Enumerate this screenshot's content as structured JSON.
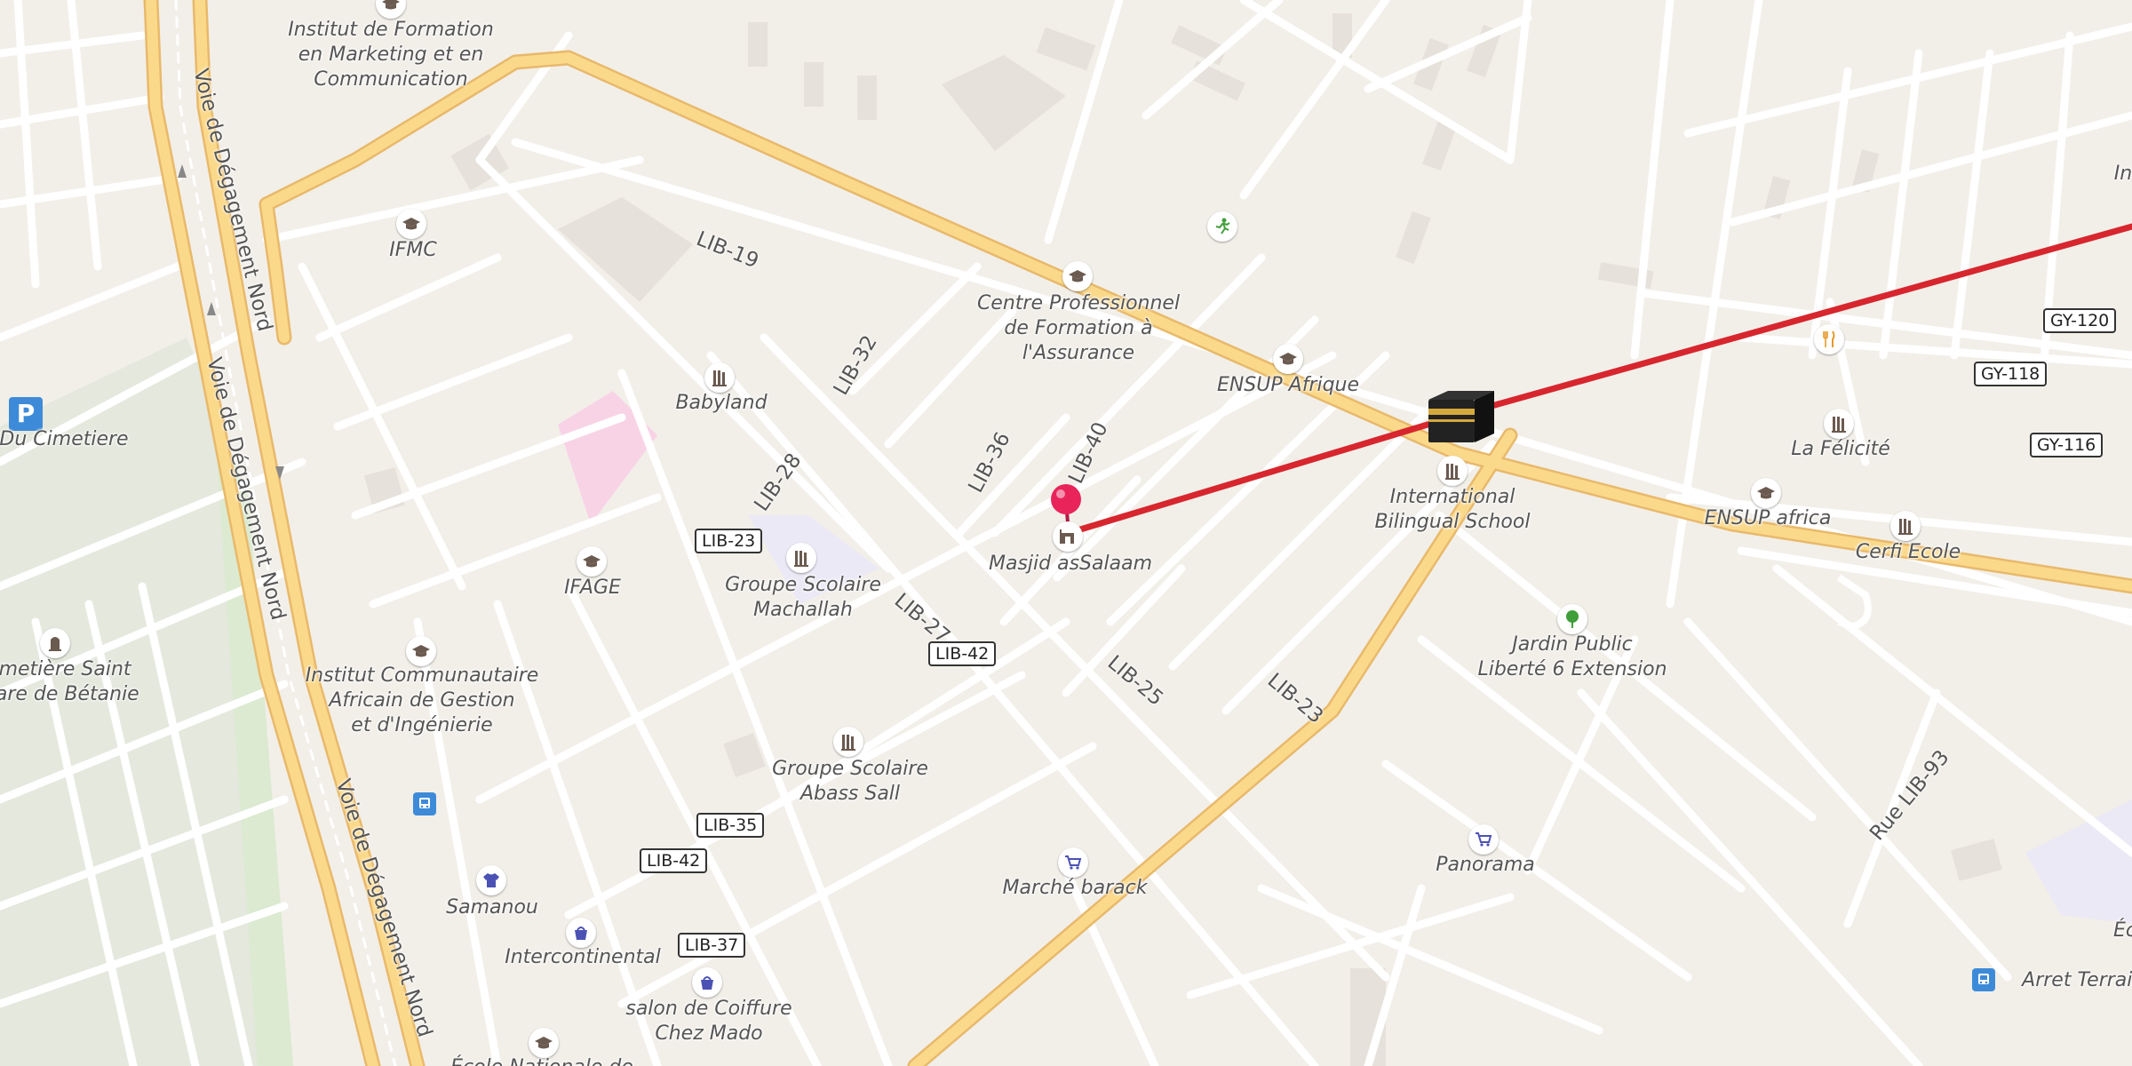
{
  "colors": {
    "background": "#f2efe9",
    "major_road": "#fbd98b",
    "major_road_casing": "#e8b96b",
    "minor_road": "#ffffff",
    "route_line": "#d7262e",
    "pin": "#e8245b",
    "poi_icon": "#6b5a50",
    "park": "#e4e8dd"
  },
  "streets": {
    "voie_1": "Voie de Dégagement Nord",
    "voie_2": "Voie de Dégagement Nord",
    "voie_3": "Voie de Dégagement Nord",
    "lib19": "LIB-19",
    "lib32": "LIB-32",
    "lib28": "LIB-28",
    "lib36": "LIB-36",
    "lib40": "LIB-40",
    "lib27": "LIB-27",
    "lib25": "LIB-25",
    "lib23": "LIB-23",
    "rue_lib93": "Rue LIB-93"
  },
  "shields": {
    "lib23": "LIB-23",
    "lib42a": "LIB-42",
    "lib35": "LIB-35",
    "lib42b": "LIB-42",
    "lib37": "LIB-37",
    "gy120": "GY-120",
    "gy118": "GY-118",
    "gy116": "GY-116"
  },
  "places": {
    "institut_marketing": "Institut de Formation\nen Marketing et en\nCommunication",
    "ifmc": "IFMC",
    "du_cimetiere": "Du Cimetiere",
    "babyland": "Babyland",
    "centre_pro": "Centre Professionnel\nde Formation à\nl'Assurance",
    "ensup_afrique": "ENSUP Afrique",
    "intl_school": "International\nBilingual School",
    "la_felicite": "La Félicité",
    "ensup_africa": "ENSUP africa",
    "cerfi": "Cerfi Ecole",
    "masjid": "Masjid asSalaam",
    "ifage": "IFAGE",
    "machallah": "Groupe Scolaire\nMachallah",
    "cimetiere": "imetière Saint\nzare de Bétanie",
    "institut_commu": "Institut Communautaire\nAfricain de Gestion\net d'Ingénierie",
    "jardin": "Jardin Public\nLiberté 6 Extension",
    "abass": "Groupe Scolaire\nAbass Sall",
    "samanou": "Samanou",
    "intercontinental": "Intercontinental",
    "marche": "Marché barack",
    "panorama": "Panorama",
    "salon": "salon de Coiffure\nChez Mado",
    "ecole_nat": "École Nationale de",
    "arret": "Arret Terrain I",
    "in_right": "In",
    "ec_right": "Éc"
  },
  "icons": {
    "parking": "P",
    "bus": "bus-stop-icon",
    "kaaba": "kaaba-icon"
  }
}
